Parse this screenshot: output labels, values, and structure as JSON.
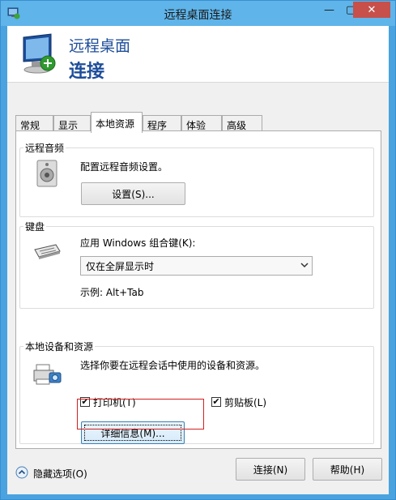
{
  "window": {
    "title": "远程桌面连接",
    "minimize_glyph": "—",
    "maximize_glyph": "▢",
    "close_glyph": "✕"
  },
  "header": {
    "line1": "远程桌面",
    "line2": "连接"
  },
  "tabs": [
    {
      "label": "常规",
      "active": false
    },
    {
      "label": "显示",
      "active": false
    },
    {
      "label": "本地资源",
      "active": true
    },
    {
      "label": "程序",
      "active": false
    },
    {
      "label": "体验",
      "active": false
    },
    {
      "label": "高级",
      "active": false
    }
  ],
  "audio": {
    "group_title": "远程音频",
    "description": "配置远程音频设置。",
    "settings_button": "设置(S)..."
  },
  "keyboard": {
    "group_title": "键盘",
    "apply_label": "应用 Windows 组合键(K):",
    "selected_option": "仅在全屏显示时",
    "example": "示例: Alt+Tab"
  },
  "devices": {
    "group_title": "本地设备和资源",
    "description": "选择你要在远程会话中使用的设备和资源。",
    "printers_label": "打印机(T)",
    "printers_checked": true,
    "clipboard_label": "剪贴板(L)",
    "clipboard_checked": true,
    "details_button": "详细信息(M)..."
  },
  "footer": {
    "hide_options": "隐藏选项(O)",
    "connect_button": "连接(N)",
    "help_button": "帮助(H)"
  },
  "icons": {
    "title_icon": "remote-desktop-icon",
    "header_icon": "remote-desktop-monitor-icon",
    "audio_icon": "speaker-icon",
    "keyboard_icon": "keyboard-icon",
    "devices_icon": "printer-camera-icon",
    "footer_icon": "chevron-up-circle-icon",
    "check_glyph": "✔"
  }
}
